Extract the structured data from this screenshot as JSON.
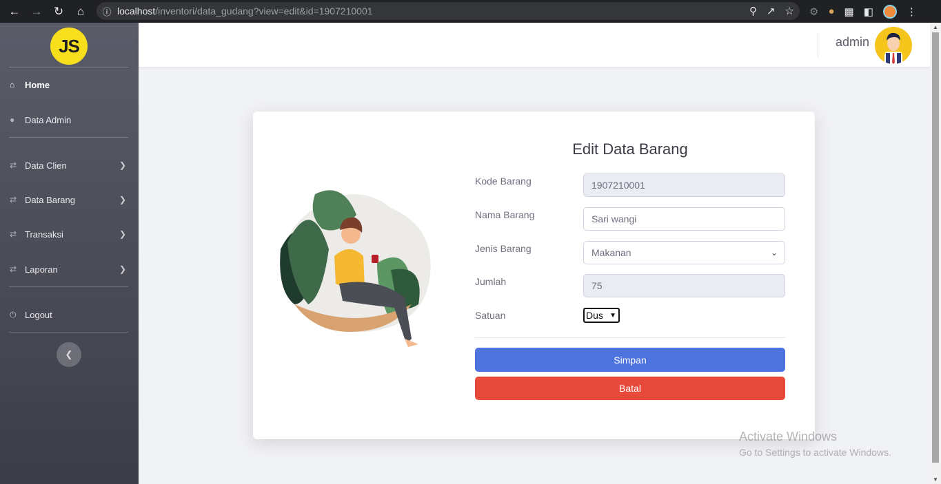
{
  "browser": {
    "url_host": "localhost",
    "url_path": "/inventori/data_gudang?view=edit&id=1907210001"
  },
  "sidebar": {
    "logo_text": "JS",
    "items": [
      {
        "label": "Home",
        "icon": "home-icon"
      },
      {
        "label": "Data Admin",
        "icon": "user-icon"
      },
      {
        "label": "Data Clien",
        "icon": "exchange-icon"
      },
      {
        "label": "Data Barang",
        "icon": "exchange-icon"
      },
      {
        "label": "Transaksi",
        "icon": "exchange-icon"
      },
      {
        "label": "Laporan",
        "icon": "exchange-icon"
      },
      {
        "label": "Logout",
        "icon": "power-icon"
      }
    ]
  },
  "topbar": {
    "username": "admin"
  },
  "form": {
    "title": "Edit Data Barang",
    "kode_label": "Kode Barang",
    "kode_value": "1907210001",
    "nama_label": "Nama Barang",
    "nama_value": "Sari wangi",
    "jenis_label": "Jenis Barang",
    "jenis_value": "Makanan",
    "jumlah_label": "Jumlah",
    "jumlah_value": "75",
    "satuan_label": "Satuan",
    "satuan_value": "Dus",
    "save_label": "Simpan",
    "cancel_label": "Batal"
  },
  "watermark": {
    "line1": "Activate Windows",
    "line2": "Go to Settings to activate Windows."
  },
  "colors": {
    "primary": "#4e73df",
    "danger": "#e74a3b",
    "logo_yellow": "#f7df1e"
  }
}
